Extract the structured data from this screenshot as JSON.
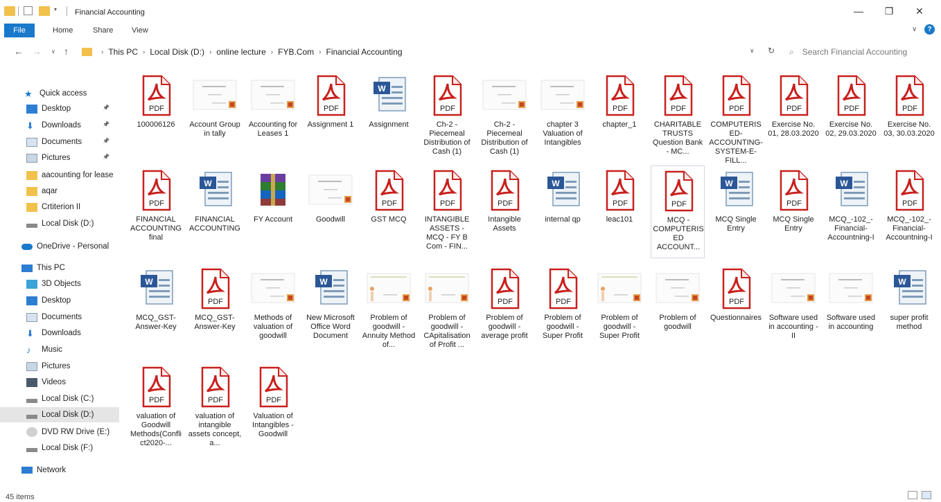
{
  "window": {
    "title": "Financial Accounting",
    "minimize": "—",
    "maximize": "❐",
    "close": "✕"
  },
  "ribbon": {
    "tabs": [
      "File",
      "Home",
      "Share",
      "View"
    ]
  },
  "address": {
    "breadcrumb": [
      "This PC",
      "Local Disk (D:)",
      "online lecture",
      "FYB.Com",
      "Financial Accounting"
    ],
    "search_placeholder": "Search Financial Accounting"
  },
  "sidebar": {
    "items": [
      {
        "label": "Quick access",
        "icon": "star-icon",
        "pinned": false
      },
      {
        "label": "Desktop",
        "icon": "desktop-icon",
        "pinned": true
      },
      {
        "label": "Downloads",
        "icon": "download-icon",
        "pinned": true
      },
      {
        "label": "Documents",
        "icon": "documents-icon",
        "pinned": true
      },
      {
        "label": "Pictures",
        "icon": "pictures-icon",
        "pinned": true
      },
      {
        "label": "aacounting for lease",
        "icon": "folder-icon",
        "pinned": false
      },
      {
        "label": "aqar",
        "icon": "folder-icon",
        "pinned": false
      },
      {
        "label": "Crtiterion II",
        "icon": "folder-icon",
        "pinned": false
      },
      {
        "label": "Local Disk (D:)",
        "icon": "drive-icon",
        "pinned": false
      },
      {
        "label": "OneDrive - Personal",
        "icon": "cloud-icon",
        "pinned": false
      },
      {
        "label": "This PC",
        "icon": "pc-icon",
        "pinned": false
      },
      {
        "label": "3D Objects",
        "icon": "cube-icon",
        "pinned": false
      },
      {
        "label": "Desktop",
        "icon": "desktop-icon",
        "pinned": false
      },
      {
        "label": "Documents",
        "icon": "documents-icon",
        "pinned": false
      },
      {
        "label": "Downloads",
        "icon": "download-icon",
        "pinned": false
      },
      {
        "label": "Music",
        "icon": "music-icon",
        "pinned": false
      },
      {
        "label": "Pictures",
        "icon": "pictures-icon",
        "pinned": false
      },
      {
        "label": "Videos",
        "icon": "videos-icon",
        "pinned": false
      },
      {
        "label": "Local Disk (C:)",
        "icon": "drive-icon",
        "pinned": false
      },
      {
        "label": "Local Disk (D:)",
        "icon": "drive-icon",
        "pinned": false,
        "selected": true
      },
      {
        "label": "DVD RW Drive (E:)",
        "icon": "dvd-icon",
        "pinned": false
      },
      {
        "label": "Local Disk (F:)",
        "icon": "drive-icon",
        "pinned": false
      },
      {
        "label": "Network",
        "icon": "network-icon",
        "pinned": false
      }
    ]
  },
  "files": [
    {
      "name": "100006126",
      "type": "pdf"
    },
    {
      "name": "Account Group in tally",
      "type": "ppt"
    },
    {
      "name": "Accounting for Leases 1",
      "type": "ppt"
    },
    {
      "name": "Assignment 1",
      "type": "pdf"
    },
    {
      "name": "Assignment",
      "type": "word"
    },
    {
      "name": "Ch-2 -Piecemeal Distribution of Cash (1)",
      "type": "pdf"
    },
    {
      "name": "Ch-2 -Piecemeal Distribution of Cash (1)",
      "type": "ppt"
    },
    {
      "name": "chapter 3 Valuation of Intangibles",
      "type": "ppt"
    },
    {
      "name": "chapter_1",
      "type": "pdf"
    },
    {
      "name": "CHARITABLE TRUSTS Question Bank - MC...",
      "type": "pdf"
    },
    {
      "name": "COMPUTERISED-ACCOUNTING-SYSTEM-E-FILL...",
      "type": "pdf"
    },
    {
      "name": "Exercise No. 01, 28.03.2020",
      "type": "pdf"
    },
    {
      "name": "Exercise No. 02, 29.03.2020",
      "type": "pdf"
    },
    {
      "name": "Exercise No. 03, 30.03.2020",
      "type": "pdf"
    },
    {
      "name": "FINANCIAL ACCOUNTING final",
      "type": "pdf"
    },
    {
      "name": "FINANCIAL ACCOUNTING",
      "type": "word"
    },
    {
      "name": "FY Account",
      "type": "rar"
    },
    {
      "name": "Goodwill",
      "type": "ppt"
    },
    {
      "name": "GST MCQ",
      "type": "pdf"
    },
    {
      "name": "INTANGIBLE ASSETS - MCQ - FY B Com - FIN...",
      "type": "pdf"
    },
    {
      "name": "Intangible Assets",
      "type": "pdf"
    },
    {
      "name": "internal qp",
      "type": "word"
    },
    {
      "name": "leac101",
      "type": "pdf"
    },
    {
      "name": "MCQ - COMPUTERISED ACCOUNT...",
      "type": "pdf",
      "highlighted": true
    },
    {
      "name": "MCQ Single Entry",
      "type": "word"
    },
    {
      "name": "MCQ Single Entry",
      "type": "pdf"
    },
    {
      "name": "MCQ_-102_-Financial-Accountning-I",
      "type": "word"
    },
    {
      "name": "MCQ_-102_-Financial-Accountning-I",
      "type": "pdf"
    },
    {
      "name": "MCQ_GST-Answer-Key",
      "type": "word"
    },
    {
      "name": "MCQ_GST-Answer-Key",
      "type": "pdf"
    },
    {
      "name": "Methods of valuation of goodwill",
      "type": "ppt"
    },
    {
      "name": "New Microsoft Office Word Document",
      "type": "word"
    },
    {
      "name": "Problem of goodwill - Annuity Method of...",
      "type": "ppt2"
    },
    {
      "name": "Problem of goodwill - CApitalisation of Profit ...",
      "type": "ppt2"
    },
    {
      "name": "Problem of goodwill - average profit",
      "type": "pdf"
    },
    {
      "name": "Problem of goodwill - Super Profit",
      "type": "pdf"
    },
    {
      "name": "Problem of goodwill - Super Profit",
      "type": "ppt2"
    },
    {
      "name": "Problem of goodwill",
      "type": "ppt"
    },
    {
      "name": "Questionnaires",
      "type": "pdf"
    },
    {
      "name": "Software used in accounting - II",
      "type": "ppt"
    },
    {
      "name": "Software used in accounting",
      "type": "ppt"
    },
    {
      "name": "super profit method",
      "type": "word"
    },
    {
      "name": "valuation of Goodwill Methods(Conflict2020-...",
      "type": "pdf"
    },
    {
      "name": "valuation of intangible assets concept, a...",
      "type": "pdf"
    },
    {
      "name": "Valuation of Intangibles - Goodwill",
      "type": "pdf"
    }
  ],
  "status": {
    "item_count": "45 items"
  },
  "colors": {
    "accent": "#1979ca",
    "pdf_red": "#c8201d",
    "folder_yellow": "#f1c14c"
  }
}
